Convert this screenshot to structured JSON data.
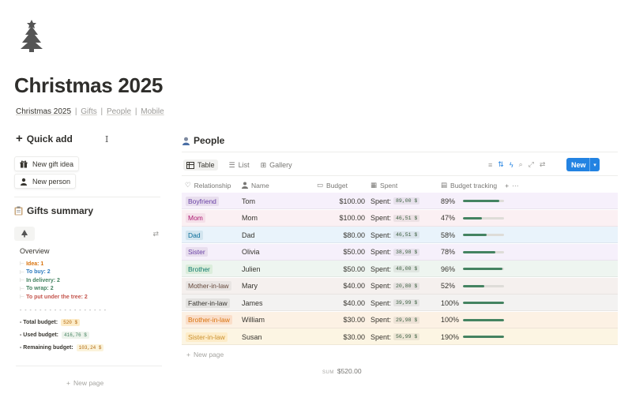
{
  "page": {
    "icon": "christmas-tree-icon",
    "title": "Christmas 2025",
    "breadcrumb": [
      "Christmas 2025",
      "Gifts",
      "People",
      "Mobile"
    ],
    "breadcrumb_sep": "|"
  },
  "quick_add": {
    "title": "Quick add",
    "buttons": [
      {
        "icon": "gift-icon",
        "label": "New gift idea"
      },
      {
        "icon": "person-icon",
        "label": "New person"
      }
    ]
  },
  "gifts_summary": {
    "title": "Gifts summary",
    "overview_title": "Overview",
    "status_lines": [
      {
        "text": "Idea: 1",
        "color": "#d9730d"
      },
      {
        "text": "To buy: 2",
        "color": "#2e7bbf"
      },
      {
        "text": "In delivery: 2",
        "color": "#448361"
      },
      {
        "text": "To wrap: 2",
        "color": "#448361"
      },
      {
        "text": "To put under the tree: 2",
        "color": "#c4554d"
      }
    ],
    "divider": "- - - - - - - - - - - - - - - - - -",
    "budget_lines": [
      {
        "label": "- Total budget:",
        "value": "520 $",
        "bg": "#fdecc8",
        "fg": "#b26a10"
      },
      {
        "label": "- Used budget:",
        "value": "416,76 $",
        "bg": "#edf3ec",
        "fg": "#448361"
      },
      {
        "label": "- Remaining budget:",
        "value": "103,24 $",
        "bg": "#fbf3db",
        "fg": "#b26a10"
      }
    ],
    "new_page": "New page"
  },
  "people": {
    "title": "People",
    "views": [
      "Table",
      "List",
      "Gallery"
    ],
    "active_view": "Table",
    "new_button": "New",
    "columns": [
      "Relationship",
      "Name",
      "Budget",
      "Spent",
      "Budget tracking"
    ],
    "rows": [
      {
        "relationship": "Boyfriend",
        "name": "Tom",
        "budget": "$100.00",
        "spent_label": "Spent:",
        "spent": "89,00 $",
        "pct_label": "89%",
        "pct": 0.89,
        "row_bg": "#f6f0fb",
        "tag_bg": "#e8deee",
        "tag_fg": "#6940a5"
      },
      {
        "relationship": "Mom",
        "name": "Mom",
        "budget": "$100.00",
        "spent_label": "Spent:",
        "spent": "46,51 $",
        "pct_label": "47%",
        "pct": 0.47,
        "row_bg": "#fbf0f3",
        "tag_bg": "#f5e0e9",
        "tag_fg": "#ad1a72"
      },
      {
        "relationship": "Dad",
        "name": "Dad",
        "budget": "$80.00",
        "spent_label": "Spent:",
        "spent": "46,51 $",
        "pct_label": "58%",
        "pct": 0.58,
        "row_bg": "#e9f3fb",
        "tag_bg": "#d3e5ef",
        "tag_fg": "#0b6e99"
      },
      {
        "relationship": "Sister",
        "name": "Olivia",
        "budget": "$50.00",
        "spent_label": "Spent:",
        "spent": "38,98 $",
        "pct_label": "78%",
        "pct": 0.78,
        "row_bg": "#f6f0fb",
        "tag_bg": "#e8deee",
        "tag_fg": "#6940a5"
      },
      {
        "relationship": "Brother",
        "name": "Julien",
        "budget": "$50.00",
        "spent_label": "Spent:",
        "spent": "48,00 $",
        "pct_label": "96%",
        "pct": 0.96,
        "row_bg": "#eef5f0",
        "tag_bg": "#dbeddb",
        "tag_fg": "#0f7b6c"
      },
      {
        "relationship": "Mother-in-law",
        "name": "Mary",
        "budget": "$40.00",
        "spent_label": "Spent:",
        "spent": "20,80 $",
        "pct_label": "52%",
        "pct": 0.52,
        "row_bg": "#f5f0ee",
        "tag_bg": "#e9e5e3",
        "tag_fg": "#64473a"
      },
      {
        "relationship": "Father-in-law",
        "name": "James",
        "budget": "$40.00",
        "spent_label": "Spent:",
        "spent": "39,99 $",
        "pct_label": "100%",
        "pct": 1.0,
        "row_bg": "#f3f2f1",
        "tag_bg": "#e3e2e0",
        "tag_fg": "#37352f"
      },
      {
        "relationship": "Brother-in-law",
        "name": "William",
        "budget": "$30.00",
        "spent_label": "Spent:",
        "spent": "29,98 $",
        "pct_label": "100%",
        "pct": 1.0,
        "row_bg": "#fcf1e4",
        "tag_bg": "#fadec9",
        "tag_fg": "#d9730d"
      },
      {
        "relationship": "Sister-in-law",
        "name": "Susan",
        "budget": "$30.00",
        "spent_label": "Spent:",
        "spent": "56,99 $",
        "pct_label": "190%",
        "pct": 1.0,
        "row_bg": "#fcf5e3",
        "tag_bg": "#fdecc8",
        "tag_fg": "#cb912f"
      }
    ],
    "new_page": "New page",
    "sum_label": "SUM",
    "sum_value": "$520.00"
  }
}
